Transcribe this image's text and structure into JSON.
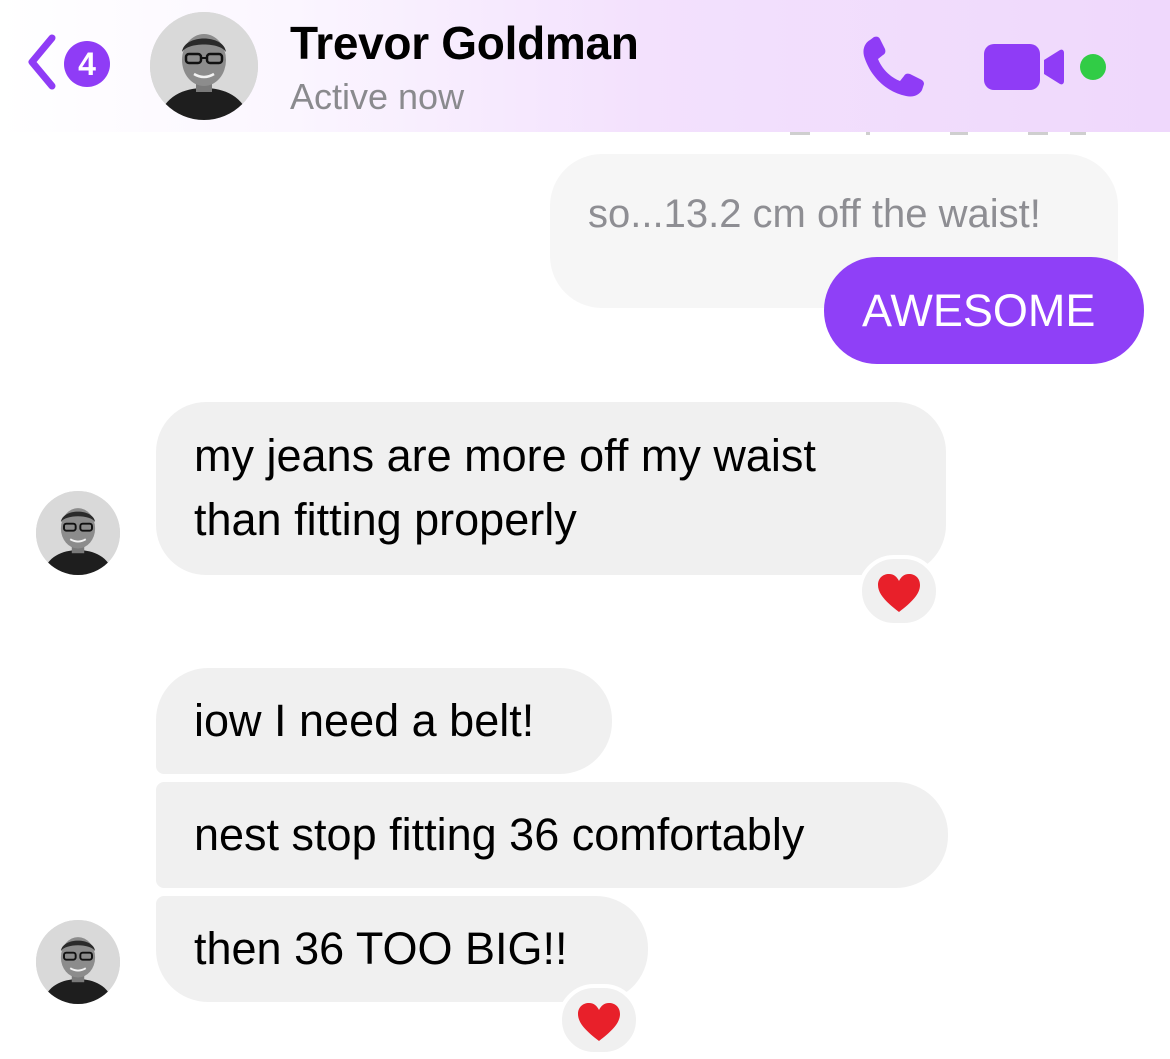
{
  "header": {
    "back_icon": "chevron-left-icon",
    "unread_count": "4",
    "contact_name": "Trevor Goldman",
    "status": "Active now",
    "call_icon": "phone-icon",
    "video_icon": "video-camera-icon",
    "online_indicator_color": "#31cc46",
    "accent_color": "#8f3cf6"
  },
  "messages": [
    {
      "sender": "me",
      "text": "so...13.2 cm off the waist!",
      "style": "faded"
    },
    {
      "sender": "me",
      "text": "AWESOME"
    },
    {
      "sender": "Trevor Goldman",
      "lines": [
        "my jeans are more off my waist",
        "than fitting properly"
      ],
      "reaction": "heart-icon"
    },
    {
      "sender": "Trevor Goldman",
      "text": "iow I need a belt!"
    },
    {
      "sender": "Trevor Goldman",
      "text": "nest stop fitting 36 comfortably"
    },
    {
      "sender": "Trevor Goldman",
      "text": "then 36 TOO BIG!!",
      "reaction": "heart-icon"
    }
  ],
  "colors": {
    "outgoing_bubble": "#8f40f7",
    "incoming_bubble": "#f0f0f0",
    "reaction_heart": "#e8202a"
  }
}
